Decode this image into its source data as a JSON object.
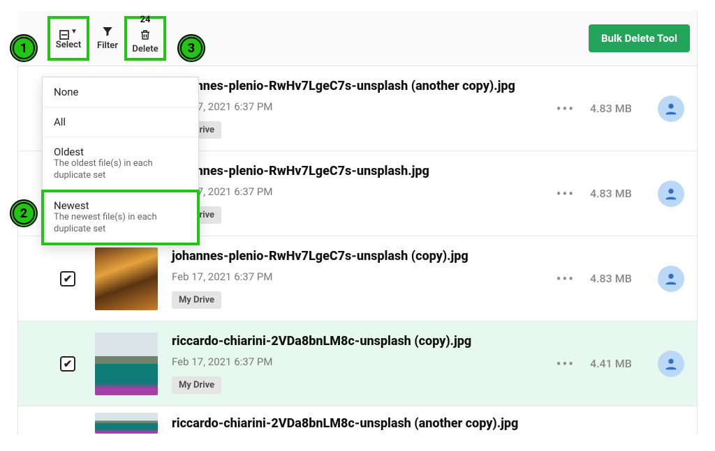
{
  "toolbar": {
    "select_label": "Select",
    "filter_label": "Filter",
    "delete_label": "Delete",
    "delete_count": "24",
    "bulk_label": "Bulk Delete Tool"
  },
  "steps": {
    "s1": "1",
    "s2": "2",
    "s3": "3"
  },
  "dropdown": {
    "none": "None",
    "all": "All",
    "oldest_title": "Oldest",
    "oldest_sub": "The oldest file(s) in each duplicate set",
    "newest_title": "Newest",
    "newest_sub": "The newest file(s) in each duplicate set"
  },
  "files": [
    {
      "name": "johannes-plenio-RwHv7LgeC7s-unsplash (another copy).jpg",
      "date": "Feb 17, 2021 6:37 PM",
      "drive": "My Drive",
      "size": "4.83 MB",
      "checked": false,
      "selected": false,
      "thumb": "t1",
      "check_mark": ""
    },
    {
      "name": "johannes-plenio-RwHv7LgeC7s-unsplash.jpg",
      "date": "Feb 17, 2021 6:37 PM",
      "drive": "My Drive",
      "size": "4.83 MB",
      "checked": false,
      "selected": false,
      "thumb": "t1",
      "check_mark": ""
    },
    {
      "name": "johannes-plenio-RwHv7LgeC7s-unsplash (copy).jpg",
      "date": "Feb 17, 2021 6:37 PM",
      "drive": "My Drive",
      "size": "4.83 MB",
      "checked": true,
      "selected": false,
      "thumb": "t1",
      "check_mark": "✔"
    },
    {
      "name": "riccardo-chiarini-2VDa8bnLM8c-unsplash (copy).jpg",
      "date": "Feb 17, 2021 6:37 PM",
      "drive": "My Drive",
      "size": "4.41 MB",
      "checked": true,
      "selected": true,
      "thumb": "t2",
      "check_mark": "✔"
    },
    {
      "name": "riccardo-chiarini-2VDa8bnLM8c-unsplash (another copy).jpg",
      "date": "",
      "drive": "",
      "size": "",
      "checked": false,
      "selected": false,
      "thumb": "t2",
      "check_mark": ""
    }
  ]
}
